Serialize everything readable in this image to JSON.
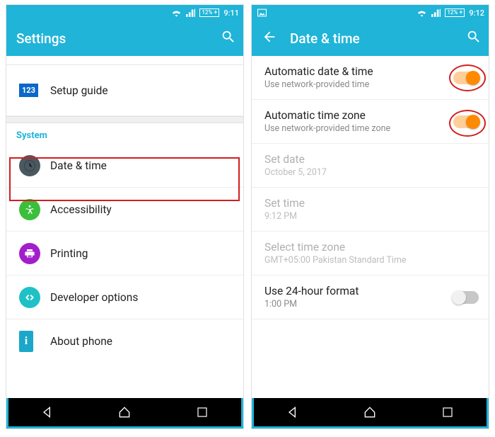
{
  "left": {
    "status": {
      "battery": "12%",
      "time": "9:11"
    },
    "appbar": {
      "title": "Settings"
    },
    "topItem": {
      "label": "Setup guide",
      "iconText": "123"
    },
    "sectionHeader": "System",
    "items": [
      {
        "label": "Date & time"
      },
      {
        "label": "Accessibility"
      },
      {
        "label": "Printing"
      },
      {
        "label": "Developer options"
      },
      {
        "label": "About phone"
      }
    ]
  },
  "right": {
    "status": {
      "battery": "12%",
      "time": "9:12"
    },
    "appbar": {
      "title": "Date & time"
    },
    "rows": [
      {
        "title": "Automatic date & time",
        "sub": "Use network-provided time",
        "toggle": "on"
      },
      {
        "title": "Automatic time zone",
        "sub": "Use network-provided time zone",
        "toggle": "on"
      },
      {
        "title": "Set date",
        "sub": "October 5, 2017",
        "disabled": true
      },
      {
        "title": "Set time",
        "sub": "9:12 PM",
        "disabled": true
      },
      {
        "title": "Select time zone",
        "sub": "GMT+05:00 Pakistan Standard Time",
        "disabled": true
      },
      {
        "title": "Use 24-hour format",
        "sub": "1:00 PM",
        "toggle": "off"
      }
    ]
  }
}
